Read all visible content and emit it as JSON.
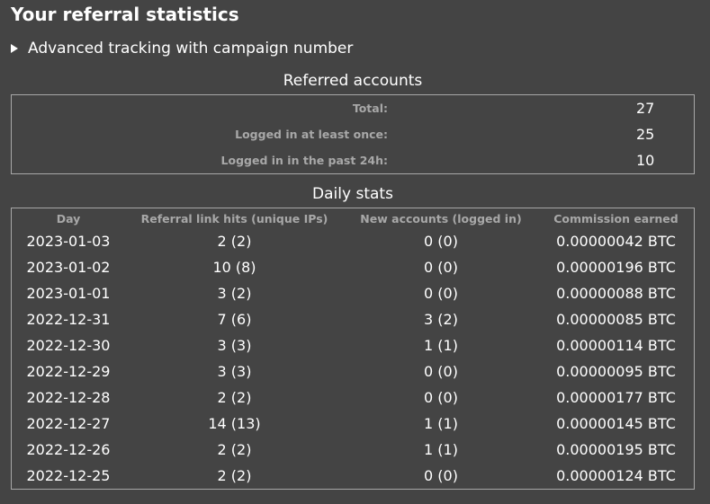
{
  "heading": "Your referral statistics",
  "advanced": {
    "label": "Advanced tracking with campaign number"
  },
  "referred": {
    "caption": "Referred accounts",
    "rows": [
      {
        "label": "Total:",
        "value": "27"
      },
      {
        "label": "Logged in at least once:",
        "value": "25"
      },
      {
        "label": "Logged in in the past 24h:",
        "value": "10"
      }
    ]
  },
  "daily": {
    "caption": "Daily stats",
    "headers": [
      "Day",
      "Referral link hits (unique IPs)",
      "New accounts (logged in)",
      "Commission earned"
    ],
    "rows": [
      [
        "2023-01-03",
        "2 (2)",
        "0 (0)",
        "0.00000042 BTC"
      ],
      [
        "2023-01-02",
        "10 (8)",
        "0 (0)",
        "0.00000196 BTC"
      ],
      [
        "2023-01-01",
        "3 (2)",
        "0 (0)",
        "0.00000088 BTC"
      ],
      [
        "2022-12-31",
        "7 (6)",
        "3 (2)",
        "0.00000085 BTC"
      ],
      [
        "2022-12-30",
        "3 (3)",
        "1 (1)",
        "0.00000114 BTC"
      ],
      [
        "2022-12-29",
        "3 (3)",
        "0 (0)",
        "0.00000095 BTC"
      ],
      [
        "2022-12-28",
        "2 (2)",
        "0 (0)",
        "0.00000177 BTC"
      ],
      [
        "2022-12-27",
        "14 (13)",
        "1 (1)",
        "0.00000145 BTC"
      ],
      [
        "2022-12-26",
        "2 (2)",
        "1 (1)",
        "0.00000195 BTC"
      ],
      [
        "2022-12-25",
        "2 (2)",
        "0 (0)",
        "0.00000124 BTC"
      ]
    ]
  }
}
